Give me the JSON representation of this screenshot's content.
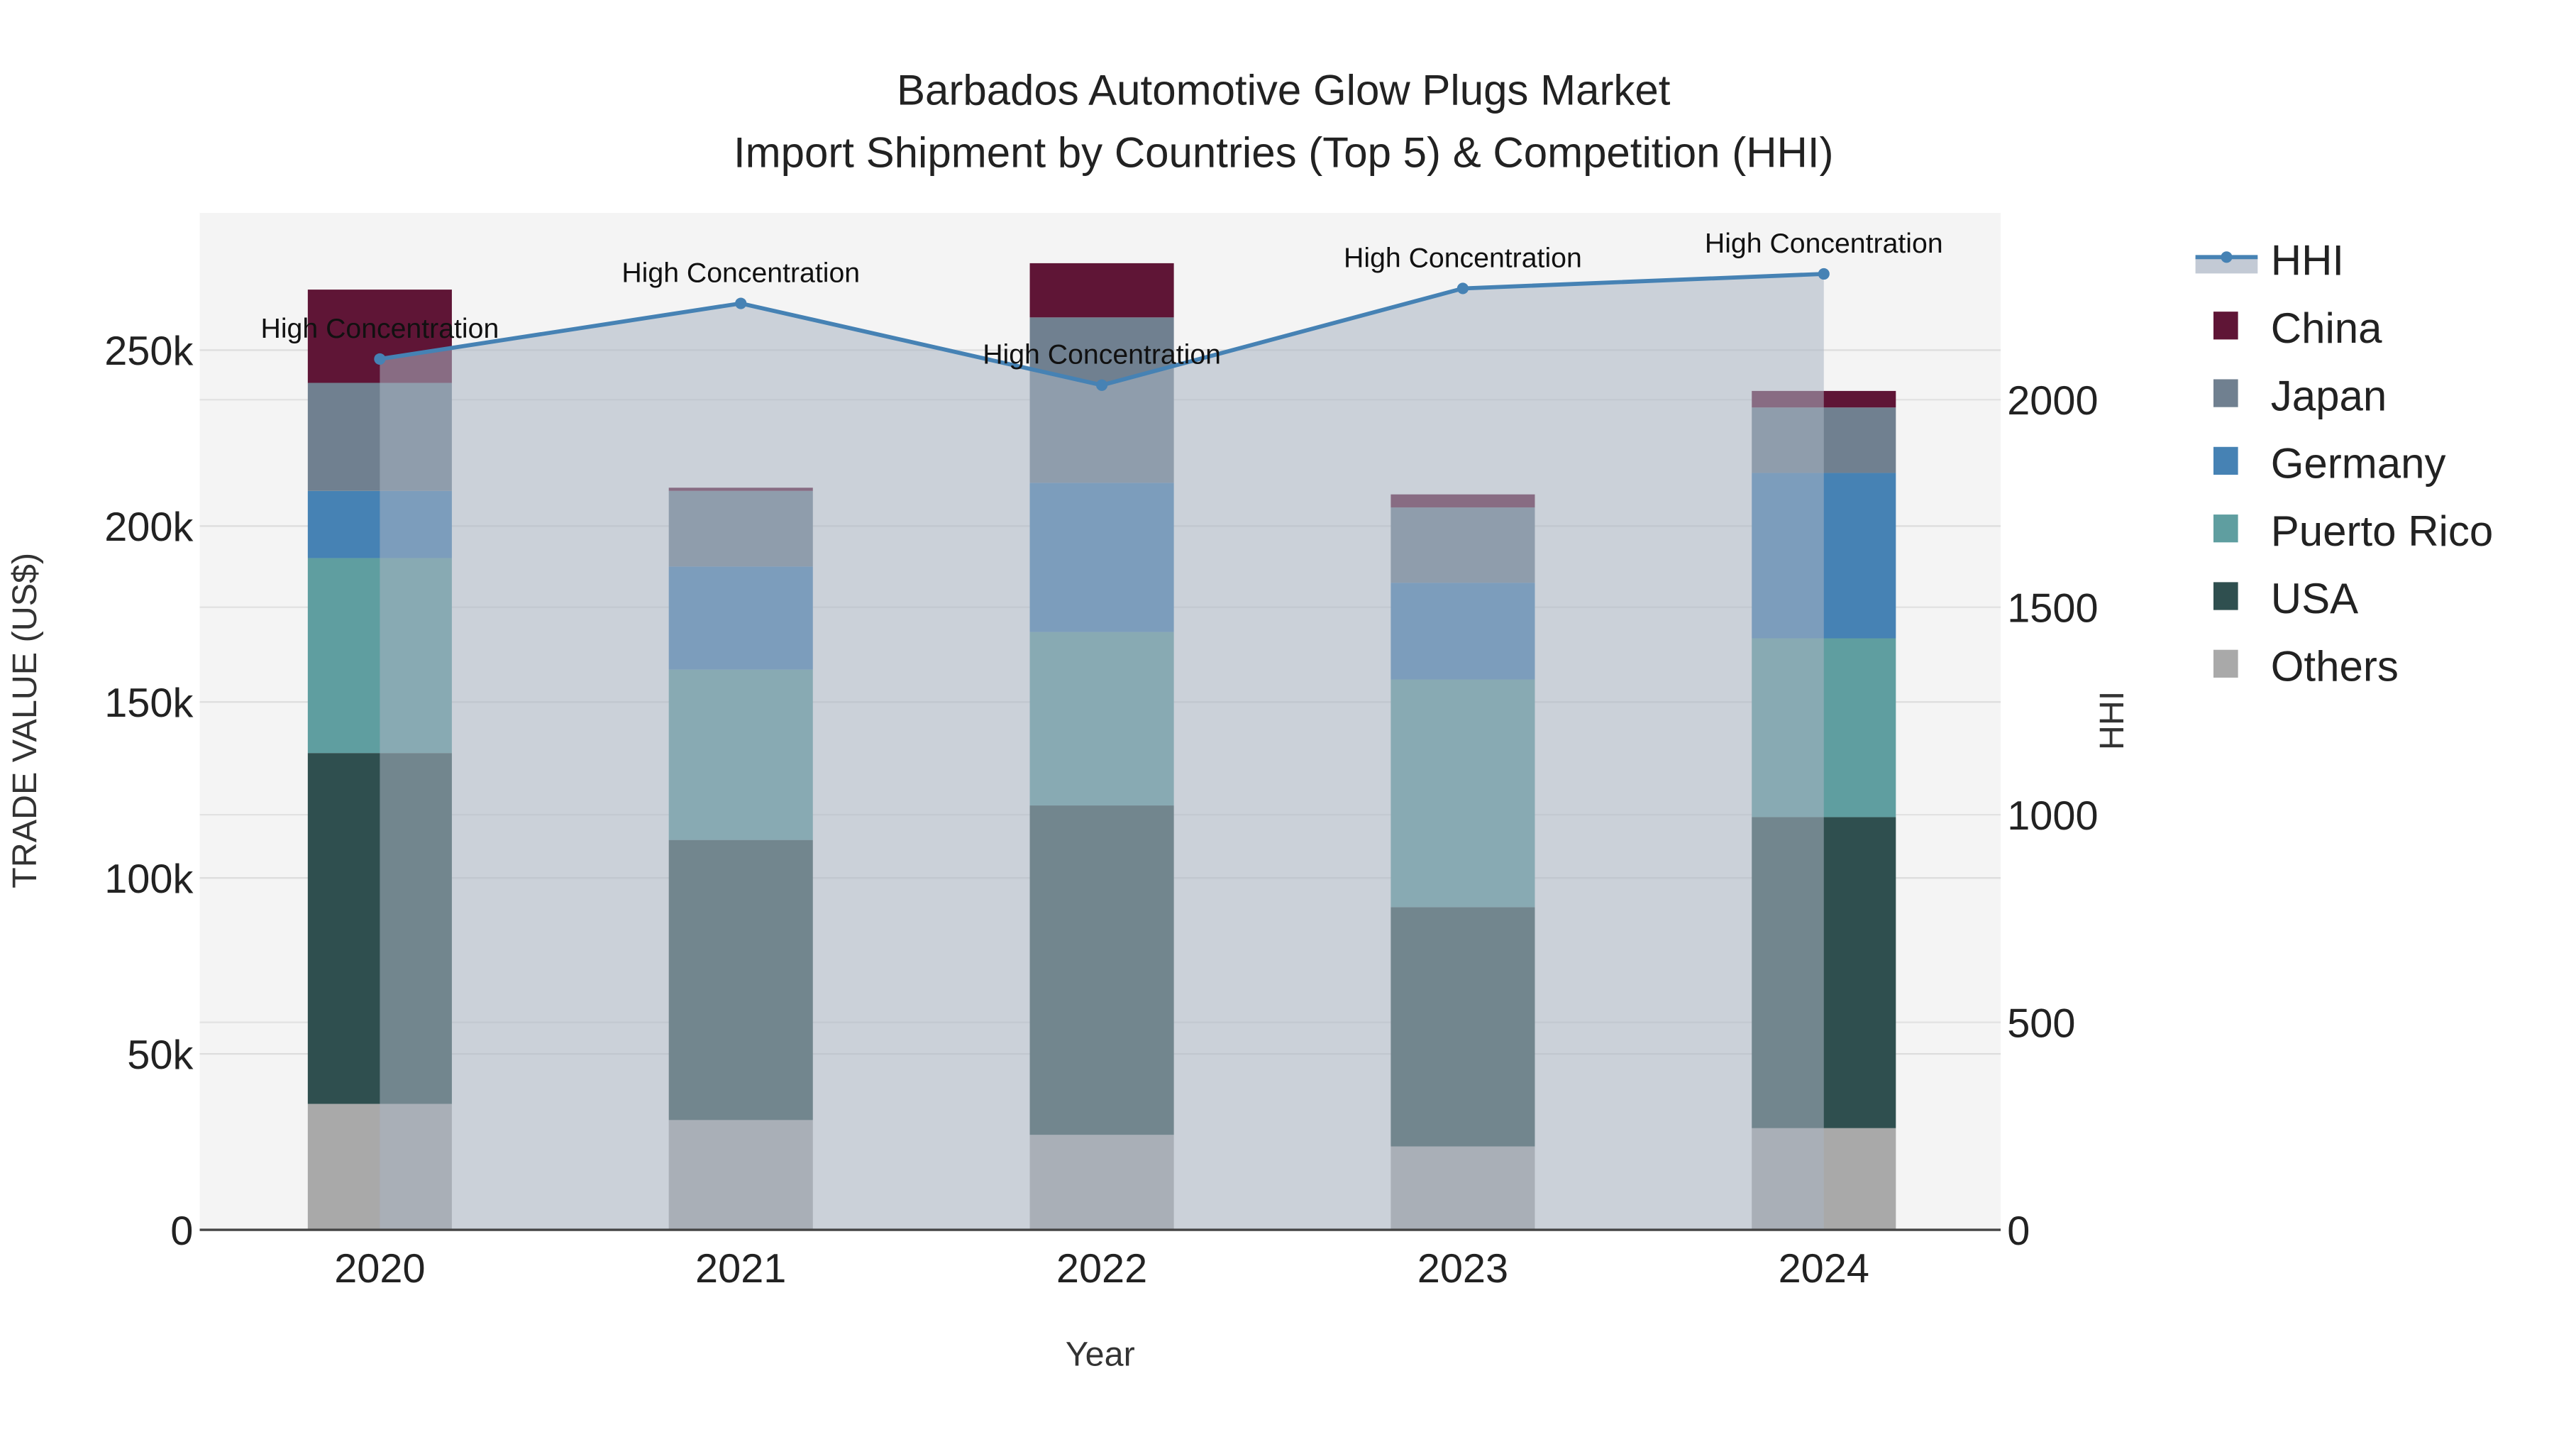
{
  "chart_data": {
    "type": "bar",
    "title": "Barbados Automotive Glow Plugs Market",
    "subtitle": "Import Shipment by Countries (Top 5) & Competition (HHI)",
    "xlabel": "Year",
    "ylabel": "TRADE VALUE (US$)",
    "y2label": "HHI",
    "categories": [
      "2020",
      "2021",
      "2022",
      "2023",
      "2024"
    ],
    "ylim": [
      0,
      289000
    ],
    "y2lim": [
      0,
      2450
    ],
    "yticks": [
      {
        "v": 0,
        "label": "0"
      },
      {
        "v": 50000,
        "label": "50k"
      },
      {
        "v": 100000,
        "label": "100k"
      },
      {
        "v": 150000,
        "label": "150k"
      },
      {
        "v": 200000,
        "label": "200k"
      },
      {
        "v": 250000,
        "label": "250k"
      }
    ],
    "y2ticks": [
      {
        "v": 0,
        "label": "0"
      },
      {
        "v": 500,
        "label": "500"
      },
      {
        "v": 1000,
        "label": "1000"
      },
      {
        "v": 1500,
        "label": "1500"
      },
      {
        "v": 2000,
        "label": "2000"
      }
    ],
    "series": [
      {
        "name": "Others",
        "color": "#a9a9a9",
        "values": [
          35800,
          31200,
          27000,
          23700,
          28900
        ]
      },
      {
        "name": "USA",
        "color": "#2f4f4f",
        "values": [
          99700,
          79600,
          93600,
          68000,
          88400
        ]
      },
      {
        "name": "Puerto Rico",
        "color": "#5f9ea0",
        "values": [
          55400,
          48400,
          49300,
          64700,
          50800
        ]
      },
      {
        "name": "Germany",
        "color": "#4682b4",
        "values": [
          19100,
          29300,
          42400,
          27500,
          47000
        ]
      },
      {
        "name": "Japan",
        "color": "#708090",
        "values": [
          30700,
          21500,
          47000,
          21400,
          18600
        ]
      },
      {
        "name": "China",
        "color": "#5f1536",
        "values": [
          26500,
          900,
          15400,
          3700,
          4700
        ]
      }
    ],
    "hhi": {
      "name": "HHI",
      "color": "#4682b4",
      "values": [
        2098,
        2232,
        2035,
        2268,
        2303
      ],
      "annotations": [
        "High Concentration",
        "High Concentration",
        "High Concentration",
        "High Concentration",
        "High Concentration"
      ]
    },
    "legend": [
      "HHI",
      "China",
      "Japan",
      "Germany",
      "Puerto Rico",
      "USA",
      "Others"
    ],
    "legend_placement": "right",
    "grid": true
  }
}
